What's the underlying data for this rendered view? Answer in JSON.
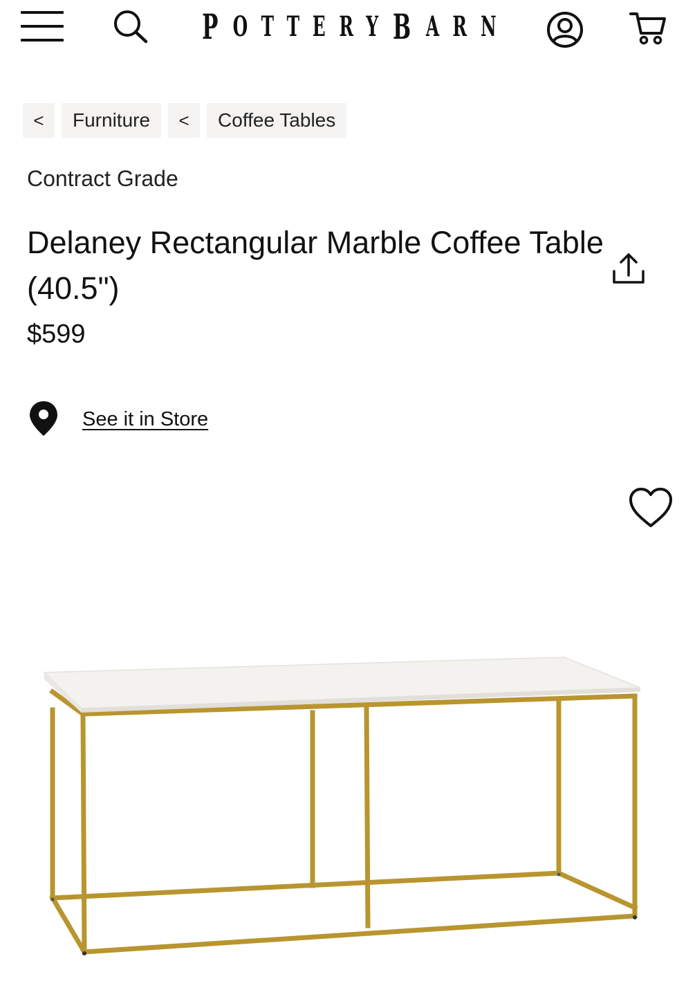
{
  "header": {
    "menu_icon": "hamburger-menu-icon",
    "search_icon": "search-icon",
    "logo_text": "POTTERYBARN",
    "account_icon": "account-icon",
    "cart_icon": "cart-icon"
  },
  "breadcrumb": {
    "items": [
      {
        "chevron": "<",
        "label": "Furniture"
      },
      {
        "chevron": "<",
        "label": "Coffee Tables"
      }
    ]
  },
  "product": {
    "eyebrow": "Contract Grade",
    "title": "Delaney Rectangular Marble Coffee Table (40.5\")",
    "price": "$599",
    "store_link": "See it in Store",
    "share_icon": "share-icon",
    "wishlist_icon": "heart-icon",
    "image_alt": "Delaney Rectangular Marble Coffee Table"
  },
  "colors": {
    "text": "#111111",
    "breadcrumb_bg": "#f5f3f1",
    "brass": "#b8952f",
    "marble": "#f3f2ef"
  }
}
